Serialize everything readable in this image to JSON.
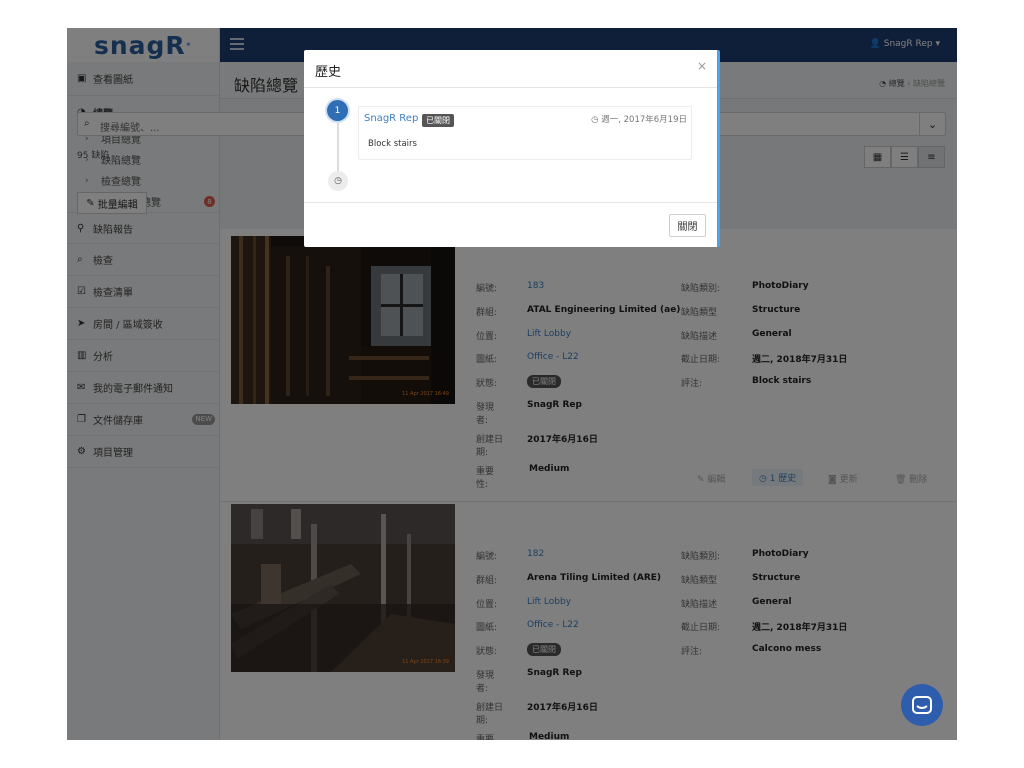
{
  "app": {
    "logo": "snagR"
  },
  "topbar": {
    "user_menu": "SnagR Rep ▾"
  },
  "sidebar": {
    "items": [
      {
        "label": "查看圖紙",
        "icon": "image-icon"
      },
      {
        "label": "總覽",
        "icon": "dashboard-icon"
      },
      {
        "label": "缺陷報告",
        "icon": "map-pin-icon"
      },
      {
        "label": "檢查",
        "icon": "search-icon"
      },
      {
        "label": "檢查清單",
        "icon": "checkbox-icon"
      },
      {
        "label": "房間 / 區域簽收",
        "icon": "send-icon"
      },
      {
        "label": "分析",
        "icon": "bar-chart-icon"
      },
      {
        "label": "我的電子郵件通知",
        "icon": "envelope-icon"
      },
      {
        "label": "文件儲存庫",
        "icon": "copy-icon",
        "badge": "NEW"
      },
      {
        "label": "項目管理",
        "icon": "cogs-icon"
      }
    ],
    "sub_items": [
      {
        "label": "項目總覽"
      },
      {
        "label": "缺陷總覽"
      },
      {
        "label": "檢查總覽"
      },
      {
        "label": "表現指標總覽",
        "badge": "8"
      }
    ]
  },
  "page": {
    "title": "缺陷總覽",
    "breadcrumb": {
      "home": "總覽",
      "separator": "›",
      "current": "缺陷總覽"
    },
    "search_placeholder": "搜尋編號、...",
    "count_label": "95 缺陷",
    "bulk_edit": "批量編輯"
  },
  "labels": {
    "number": "編號:",
    "group": "群組:",
    "location": "位置:",
    "drawing": "圖紙:",
    "status": "狀態:",
    "found_by": "發現者:",
    "created": "創建日期:",
    "severity": "重要性:",
    "category": "缺陷類別:",
    "type": "缺陷類型",
    "description": "缺陷描述",
    "due": "截止日期:",
    "comment": "評注:"
  },
  "actions": {
    "edit": "編輯",
    "history": "1 歷史",
    "update": "更新",
    "delete": "刪除"
  },
  "defects": [
    {
      "number": "183",
      "group": "ATAL Engineering Limited  (ae)",
      "location": "Lift Lobby",
      "drawing": "Office - L22",
      "status": "已關閉",
      "found_by": "SnagR Rep",
      "created": "2017年6月16日",
      "severity": "Medium",
      "category": "PhotoDiary",
      "type": "Structure",
      "description": "General",
      "due": "週二, 2018年7月31日",
      "comment": "Block stairs",
      "photo_stamp": "11 Apr 2017 16:49"
    },
    {
      "number": "182",
      "group": "Arena Tiling Limited  (ARE)",
      "location": "Lift Lobby",
      "drawing": "Office - L22",
      "status": "已關閉",
      "found_by": "SnagR Rep",
      "created": "2017年6月16日",
      "severity": "Medium",
      "category": "PhotoDiary",
      "type": "Structure",
      "description": "General",
      "due": "週二, 2018年7月31日",
      "comment": "Calcono mess",
      "photo_stamp": "11 Apr 2017 16:39"
    }
  ],
  "modal": {
    "title": "歷史",
    "close_x": "×",
    "step_number": "1",
    "entry": {
      "user": "SnagR Rep",
      "badge": "已關閉",
      "timestamp": "週一, 2017年6月19日",
      "note": "Block stairs"
    },
    "close_button": "關閉"
  },
  "colors": {
    "topbar": "#1f3f73",
    "accent": "#3b7fc4",
    "status_pill": "#555555",
    "fab": "#2f5dad"
  }
}
